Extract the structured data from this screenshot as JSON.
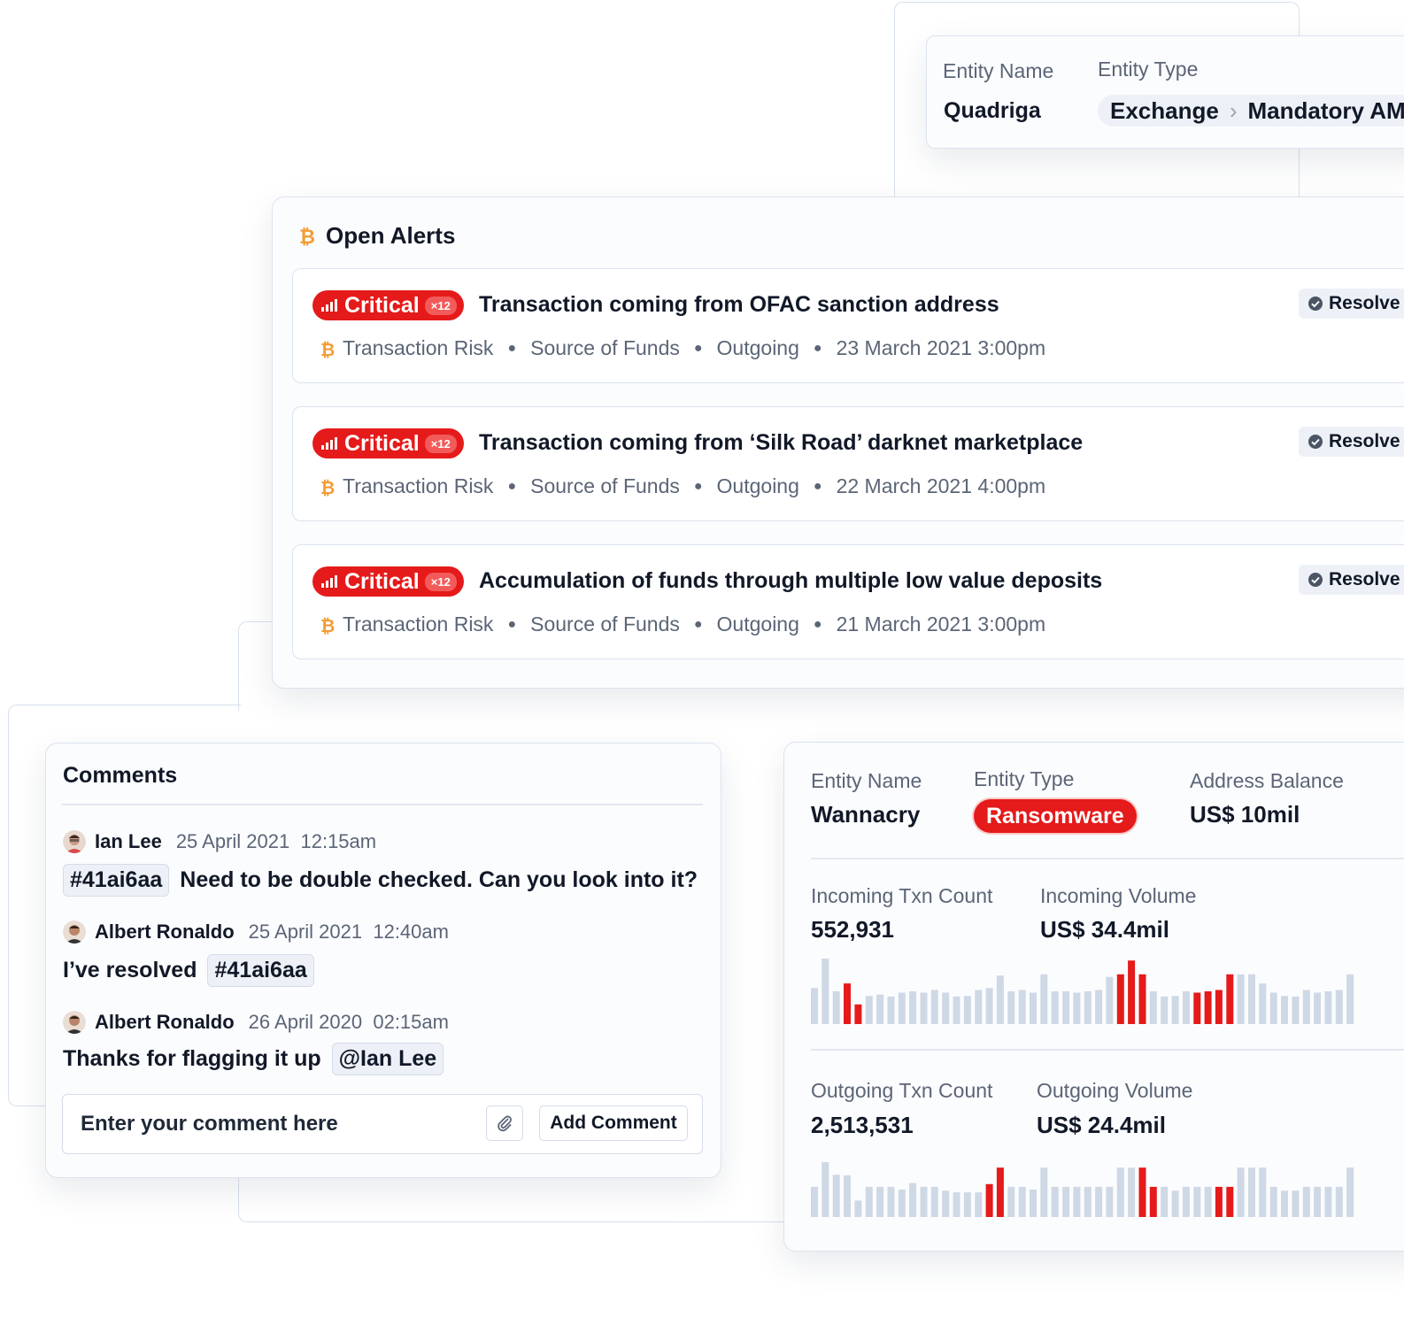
{
  "top_entity": {
    "name_label": "Entity Name",
    "name_value": "Quadriga",
    "type_label": "Entity Type",
    "type_value": "Exchange",
    "type_extra": "Mandatory AML"
  },
  "alerts": {
    "title": "Open Alerts",
    "items": [
      {
        "severity": "Critical",
        "count": "×12",
        "title": "Transaction coming from OFAC sanction address",
        "category": "Transaction Risk",
        "source": "Source of Funds",
        "direction": "Outgoing",
        "date": "23 March 2021 3:00pm",
        "action": "Resolve"
      },
      {
        "severity": "Critical",
        "count": "×12",
        "title": "Transaction coming from ‘Silk Road’ darknet marketplace",
        "category": "Transaction Risk",
        "source": "Source of Funds",
        "direction": "Outgoing",
        "date": "22 March 2021 4:00pm",
        "action": "Resolve"
      },
      {
        "severity": "Critical",
        "count": "×12",
        "title": "Accumulation of funds through multiple low value deposits",
        "category": "Transaction Risk",
        "source": "Source of Funds",
        "direction": "Outgoing",
        "date": "21 March 2021 3:00pm",
        "action": "Resolve"
      }
    ]
  },
  "comments": {
    "title": "Comments",
    "items": [
      {
        "author": "Ian Lee",
        "date": "25 April 2021",
        "time": "12:15am",
        "tag": "#41ai6aa",
        "text": "Need to be double checked. Can you look into it?"
      },
      {
        "author": "Albert Ronaldo",
        "date": "25 April 2021",
        "time": "12:40am",
        "text": "I’ve resolved",
        "tag": "#41ai6aa"
      },
      {
        "author": "Albert Ronaldo",
        "date": "26 April 2020",
        "time": "02:15am",
        "text": "Thanks for flagging it up",
        "tag": "@Ian Lee"
      }
    ],
    "input_placeholder": "Enter your comment here",
    "add_button": "Add Comment"
  },
  "entity_detail": {
    "name_label": "Entity Name",
    "name_value": "Wannacry",
    "type_label": "Entity Type",
    "type_value": "Ransomware",
    "balance_label": "Address Balance",
    "balance_value": "US$ 10mil",
    "incoming_count_label": "Incoming Txn Count",
    "incoming_count_value": "552,931",
    "incoming_volume_label": "Incoming Volume",
    "incoming_volume_value": "US$ 34.4mil",
    "outgoing_count_label": "Outgoing Txn Count",
    "outgoing_count_value": "2,513,531",
    "outgoing_volume_label": "Outgoing Volume",
    "outgoing_volume_value": "US$ 24.4mil"
  },
  "colors": {
    "critical": "#e51a1a",
    "bar_normal": "#cfd8e5",
    "bar_flagged": "#e51a1a",
    "btc_orange": "#f39c33",
    "border": "#dbe3ee"
  },
  "chart_data": [
    {
      "type": "bar",
      "name": "incoming-sparkline",
      "values": [
        0.55,
        1,
        0.5,
        0.62,
        0.3,
        0.43,
        0.45,
        0.42,
        0.48,
        0.5,
        0.48,
        0.52,
        0.48,
        0.42,
        0.43,
        0.52,
        0.55,
        0.74,
        0.5,
        0.52,
        0.48,
        0.76,
        0.5,
        0.5,
        0.48,
        0.5,
        0.52,
        0.72,
        0.76,
        0.97,
        0.76,
        0.5,
        0.42,
        0.43,
        0.5,
        0.48,
        0.5,
        0.52,
        0.76,
        0.76,
        0.76,
        0.62,
        0.48,
        0.43,
        0.42,
        0.52,
        0.48,
        0.5,
        0.52,
        0.76
      ],
      "flagged": [
        0,
        0,
        0,
        1,
        1,
        0,
        0,
        0,
        0,
        0,
        0,
        0,
        0,
        0,
        0,
        0,
        0,
        0,
        0,
        0,
        0,
        0,
        0,
        0,
        0,
        0,
        0,
        0,
        1,
        1,
        1,
        0,
        0,
        0,
        0,
        1,
        1,
        1,
        1,
        0,
        0,
        0,
        0,
        0,
        0,
        0,
        0,
        0,
        0,
        0
      ]
    },
    {
      "type": "bar",
      "name": "outgoing-sparkline",
      "values": [
        0.55,
        1,
        0.77,
        0.76,
        0.3,
        0.55,
        0.55,
        0.55,
        0.5,
        0.62,
        0.55,
        0.55,
        0.48,
        0.45,
        0.45,
        0.45,
        0.6,
        0.9,
        0.55,
        0.55,
        0.5,
        0.9,
        0.55,
        0.55,
        0.55,
        0.55,
        0.55,
        0.55,
        0.9,
        0.9,
        0.9,
        0.55,
        0.55,
        0.48,
        0.55,
        0.55,
        0.55,
        0.55,
        0.55,
        0.9,
        0.9,
        0.9,
        0.55,
        0.48,
        0.48,
        0.55,
        0.55,
        0.55,
        0.55,
        0.9
      ],
      "flagged": [
        0,
        0,
        0,
        0,
        0,
        0,
        0,
        0,
        0,
        0,
        0,
        0,
        0,
        0,
        0,
        0,
        1,
        1,
        0,
        0,
        0,
        0,
        0,
        0,
        0,
        0,
        0,
        0,
        0,
        0,
        1,
        1,
        0,
        0,
        0,
        0,
        0,
        1,
        1,
        0,
        0,
        0,
        0,
        0,
        0,
        0,
        0,
        0,
        0,
        0
      ]
    }
  ]
}
